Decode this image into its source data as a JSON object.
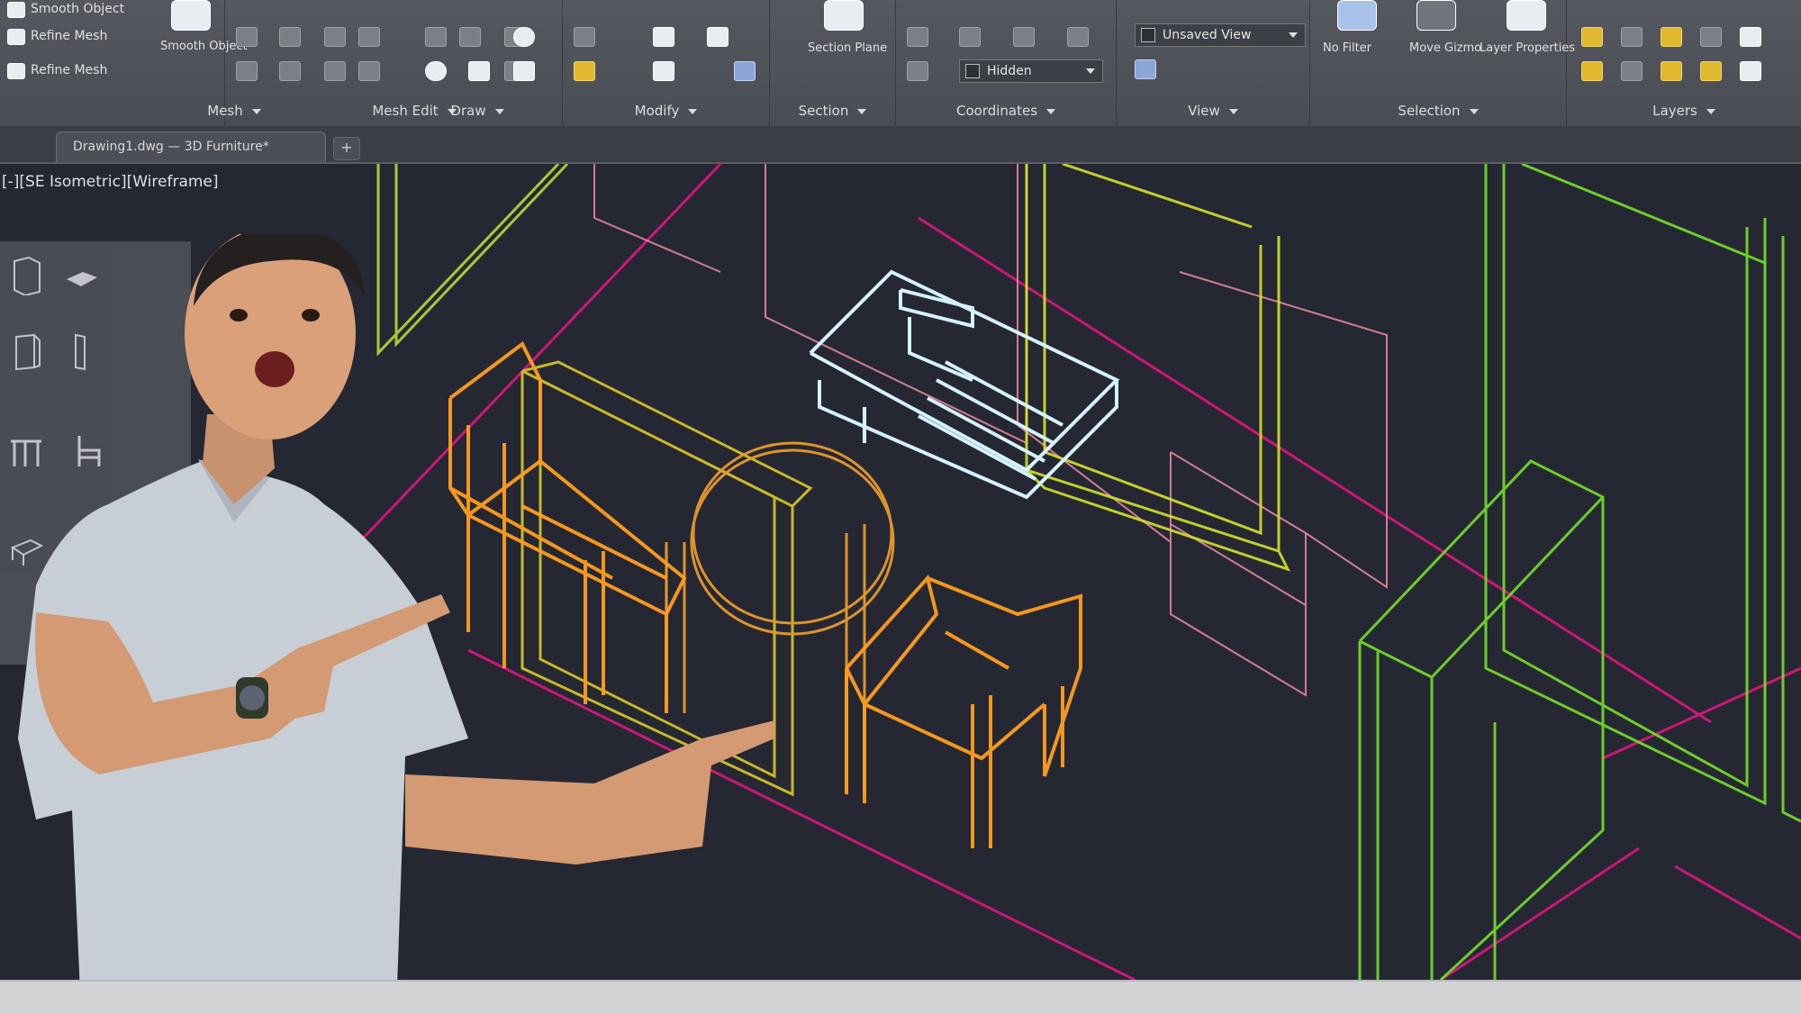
{
  "ribbon": {
    "panels": [
      {
        "title": "Mesh",
        "tools": [
          "box-icon",
          "cylinder-icon",
          "smooth-icon"
        ]
      },
      {
        "title": "Mesh Edit",
        "tools": [
          "extrude-icon",
          "merge-icon"
        ]
      },
      {
        "title": "Draw",
        "tools": [
          "line-icon",
          "arc-icon",
          "circle-icon"
        ]
      },
      {
        "title": "Modify",
        "tools": [
          "move-icon",
          "rotate-icon",
          "array-icon"
        ]
      },
      {
        "title": "Section",
        "tools": [
          "section-plane-icon"
        ]
      },
      {
        "title": "Coordinates",
        "tools": [
          "ucs-icon",
          "world-icon"
        ]
      },
      {
        "title": "View",
        "tools": [
          "visual-style-icon"
        ]
      },
      {
        "title": "Selection",
        "tools": [
          "culling-icon"
        ]
      },
      {
        "title": "Layers",
        "tools": [
          "layer-icon"
        ]
      }
    ],
    "left_items": [
      "Smooth Object",
      "Refine Mesh"
    ],
    "left_big_label": "Smooth Object",
    "section_big_label": "Section Plane",
    "combo_layer": "Unsaved View",
    "combo_style": "Hidden",
    "selection_big_label": "No Filter",
    "culling_label": "Move Gizmo",
    "ucs_label": "Layer Properties",
    "collapse_label": "▾"
  },
  "tabs": {
    "document": "Drawing1.dwg — 3D Furniture*",
    "new": "+"
  },
  "viewport": {
    "label": "[-][SE Isometric][Wireframe]"
  },
  "palette": {
    "icons": [
      "cabinet-icon",
      "sofa-icon",
      "wardrobe-icon",
      "door-icon",
      "table-icon",
      "chair-icon",
      "bed-icon"
    ]
  },
  "colors": {
    "accent": "#ff9d1f",
    "wire_pink": "#e0157f",
    "wire_green": "#72d52a",
    "wire_yellow": "#d4e22c",
    "wire_cyan": "#d4f2ff"
  }
}
